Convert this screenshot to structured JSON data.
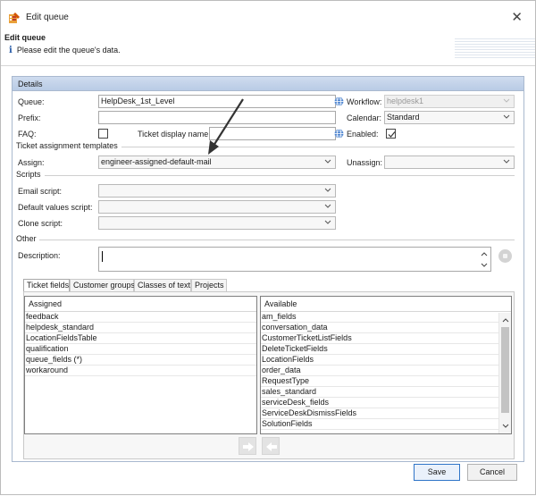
{
  "window": {
    "title": "Edit queue",
    "close_glyph": "✕"
  },
  "header": {
    "title": "Edit queue",
    "info_glyph": "i",
    "info_text": "Please edit the queue's data."
  },
  "details": {
    "panel_title": "Details",
    "queue_label": "Queue:",
    "queue_value": "HelpDesk_1st_Level",
    "workflow_label": "Workflow:",
    "workflow_value": "helpdesk1",
    "prefix_label": "Prefix:",
    "prefix_value": "",
    "calendar_label": "Calendar:",
    "calendar_value": "Standard",
    "faq_label": "FAQ:",
    "faq_checked": false,
    "ticket_display_name_label": "Ticket display name:",
    "ticket_display_name_value": "",
    "enabled_label": "Enabled:",
    "enabled_checked": true
  },
  "ticket_assignment": {
    "section_title": "Ticket assignment templates",
    "assign_label": "Assign:",
    "assign_value": "engineer-assigned-default-mail",
    "unassign_label": "Unassign:",
    "unassign_value": ""
  },
  "scripts": {
    "section_title": "Scripts",
    "email_script_label": "Email script:",
    "default_values_script_label": "Default values script:",
    "clone_script_label": "Clone script:"
  },
  "other": {
    "section_title": "Other",
    "description_label": "Description:",
    "description_value": ""
  },
  "tabs": [
    {
      "label": "Ticket fields",
      "active": true
    },
    {
      "label": "Customer groups",
      "active": false
    },
    {
      "label": "Classes of text",
      "active": false
    },
    {
      "label": "Projects",
      "active": false
    }
  ],
  "assigned": {
    "header": "Assigned",
    "items": [
      "feedback",
      "helpdesk_standard",
      "LocationFieldsTable",
      "qualification",
      "queue_fields (*)",
      "workaround"
    ]
  },
  "available": {
    "header": "Available",
    "items": [
      "am_fields",
      "conversation_data",
      "CustomerTicketListFields",
      "DeleteTicketFields",
      "LocationFields",
      "order_data",
      "RequestType",
      "sales_standard",
      "serviceDesk_fields",
      "ServiceDeskDismissFields",
      "SolutionFields"
    ]
  },
  "buttons": {
    "save_label": "Save",
    "cancel_label": "Cancel"
  },
  "icons": {
    "app": "edit-queue-app-icon",
    "globe": "globe-icon",
    "chevron": "chevron-down-icon",
    "move_right": "arrow-right-icon",
    "move_left": "arrow-left-icon"
  },
  "colors": {
    "panel_header": "#c4d4ea",
    "primary_border": "#2e74c8",
    "info_icon": "#2a5da8"
  }
}
